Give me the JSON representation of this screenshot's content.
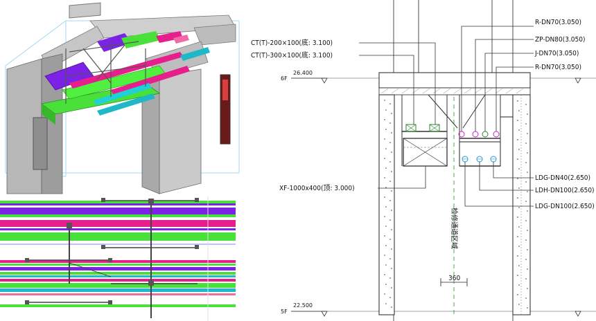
{
  "section": {
    "levels": [
      {
        "floor": "6F",
        "elevation": "26.400"
      },
      {
        "floor": "5F",
        "elevation": "22.500"
      }
    ],
    "labels_left": [
      "CT(T)-200×100(底: 3.100)",
      "CT(T)-300×100(底: 3.100)",
      "XF-1000x400(顶: 3.000)"
    ],
    "labels_right_top": [
      "R-DN70(3.050)",
      "ZP-DN80(3.050)",
      "J-DN70(3.050)",
      "R-DN70(3.050)"
    ],
    "labels_right_bottom": [
      "LDG-DN40(2.650)",
      "LDH-DN100(2.650)",
      "LDG-DN100(2.650)"
    ],
    "dimension": "360",
    "corridor_text": "检修通道区域"
  },
  "colors": {
    "purple": "#7b22e6",
    "magenta": "#e61f8c",
    "green": "#49e03a",
    "cyan": "#1fb8c8",
    "pink": "#f06aa8",
    "concrete": "#bdbdbd"
  }
}
